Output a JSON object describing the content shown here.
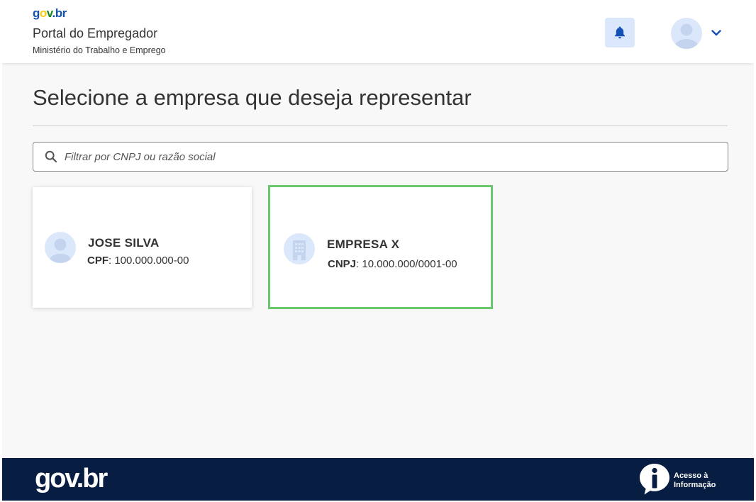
{
  "header": {
    "logo": {
      "g": "g",
      "o": "o",
      "v": "v",
      "b": ".br"
    },
    "portal_title": "Portal do Empregador",
    "portal_subtitle": "Ministério do Trabalho e Emprego",
    "bell_icon": "bell-icon",
    "avatar_icon": "user-avatar-icon",
    "chevron_icon": "chevron-down-icon"
  },
  "main": {
    "title": "Selecione a empresa que deseja representar",
    "search": {
      "placeholder": "Filtrar por CNPJ ou razão social",
      "value": "",
      "icon": "search-icon"
    },
    "cards": [
      {
        "name": "JOSE SILVA",
        "doc_label": "CPF",
        "doc_value": ": 100.000.000-00",
        "icon": "person-icon"
      },
      {
        "name": "EMPRESA X",
        "doc_label": "CNPJ",
        "doc_value": ": 10.000.000/0001-00",
        "icon": "building-icon"
      }
    ]
  },
  "footer": {
    "logo": "gov.br",
    "acesso_line1": "Acesso à",
    "acesso_line2": "Informação",
    "acesso_icon": "info-icon"
  },
  "colors": {
    "primary": "#1351b4",
    "footer_bg": "#071d41",
    "highlight_border": "#69c86d",
    "light_blue": "#dbe8fb"
  }
}
